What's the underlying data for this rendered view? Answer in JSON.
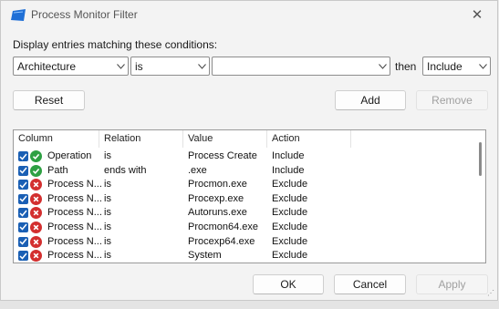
{
  "window": {
    "title": "Process Monitor Filter"
  },
  "prompt": "Display entries matching these conditions:",
  "condition": {
    "column": "Architecture",
    "relation": "is",
    "value": "",
    "then_label": "then",
    "action": "Include"
  },
  "buttons": {
    "reset": "Reset",
    "add": "Add",
    "remove": "Remove",
    "ok": "OK",
    "cancel": "Cancel",
    "apply": "Apply"
  },
  "list": {
    "headers": [
      "Column",
      "Relation",
      "Value",
      "Action"
    ],
    "rows": [
      {
        "column": "Operation",
        "relation": "is",
        "value": "Process Create",
        "action": "Include",
        "type": "include"
      },
      {
        "column": "Path",
        "relation": "ends with",
        "value": ".exe",
        "action": "Include",
        "type": "include"
      },
      {
        "column": "Process N...",
        "relation": "is",
        "value": "Procmon.exe",
        "action": "Exclude",
        "type": "exclude"
      },
      {
        "column": "Process N...",
        "relation": "is",
        "value": "Procexp.exe",
        "action": "Exclude",
        "type": "exclude"
      },
      {
        "column": "Process N...",
        "relation": "is",
        "value": "Autoruns.exe",
        "action": "Exclude",
        "type": "exclude"
      },
      {
        "column": "Process N...",
        "relation": "is",
        "value": "Procmon64.exe",
        "action": "Exclude",
        "type": "exclude"
      },
      {
        "column": "Process N...",
        "relation": "is",
        "value": "Procexp64.exe",
        "action": "Exclude",
        "type": "exclude"
      },
      {
        "column": "Process N...",
        "relation": "is",
        "value": "System",
        "action": "Exclude",
        "type": "exclude"
      }
    ]
  },
  "colors": {
    "include": "#2ea043",
    "exclude": "#d32f2f",
    "checkbox": "#1a5fb4",
    "app_icon": "#1f6fd6"
  },
  "icons": {
    "app": "process-monitor-icon",
    "close": "close-icon",
    "chevron": "chevron-down-icon",
    "include": "check-circle-icon",
    "exclude": "x-circle-icon",
    "checkbox": "checkbox-checked-icon"
  }
}
